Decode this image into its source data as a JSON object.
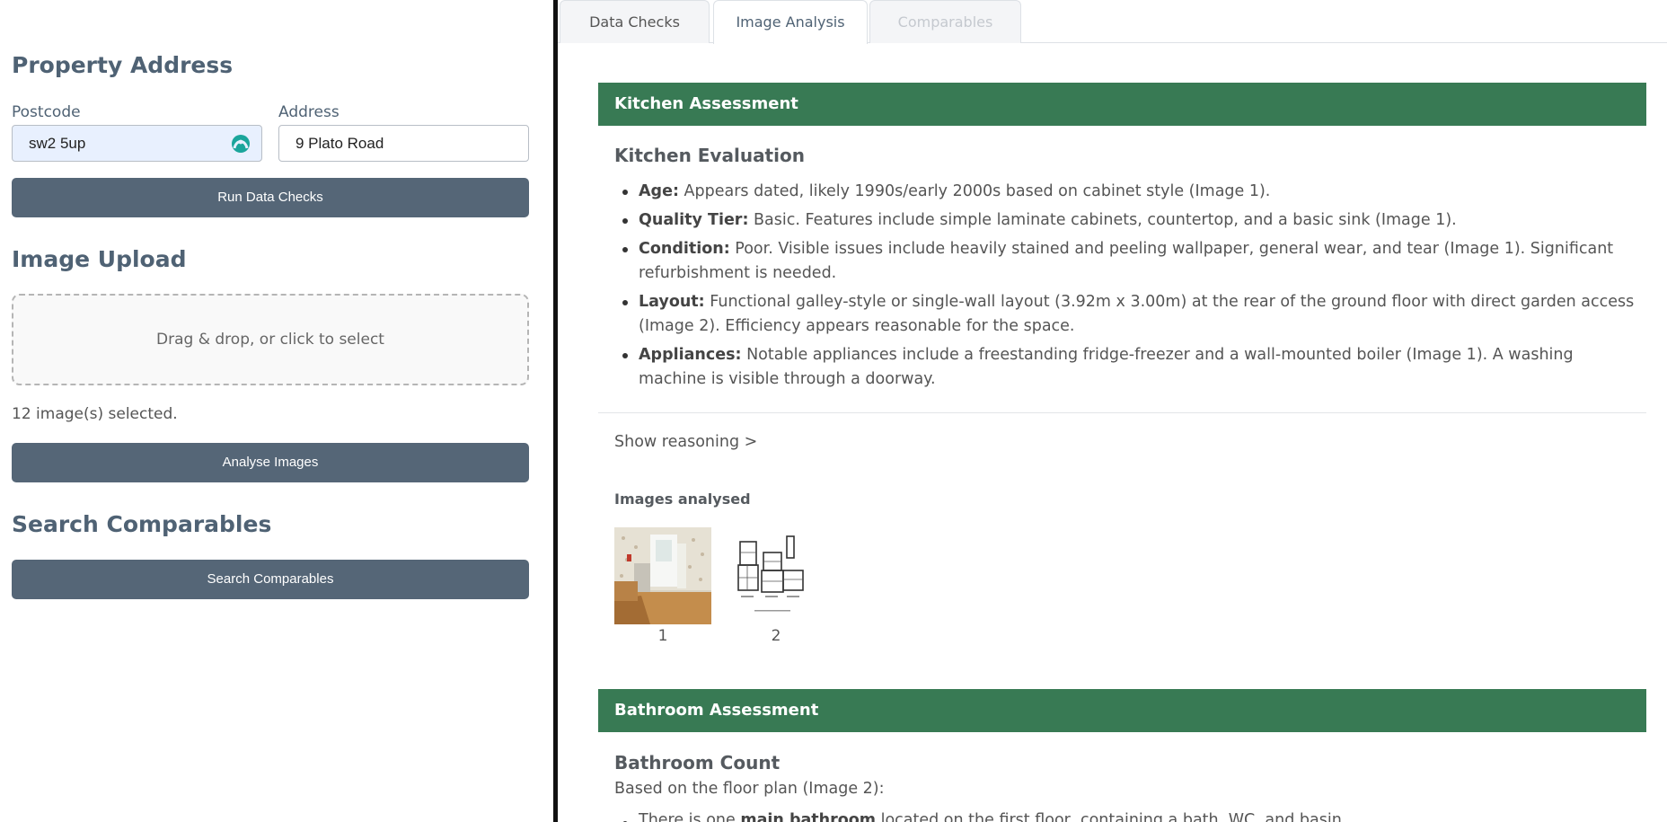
{
  "left_panel": {
    "property_address": {
      "heading": "Property Address",
      "postcode_label": "Postcode",
      "postcode_value": "sw2 5up",
      "address_label": "Address",
      "address_value": "9 Plato Road",
      "run_button": "Run Data Checks"
    },
    "image_upload": {
      "heading": "Image Upload",
      "dropzone_text": "Drag & drop, or click to select",
      "selected_text": "12 image(s) selected.",
      "analyse_button": "Analyse Images"
    },
    "comparables": {
      "heading": "Search Comparables",
      "search_button": "Search Comparables"
    }
  },
  "tabs": [
    {
      "label": "Data Checks",
      "state": "inactive"
    },
    {
      "label": "Image Analysis",
      "state": "active"
    },
    {
      "label": "Comparables",
      "state": "disabled"
    }
  ],
  "kitchen": {
    "section_title": "Kitchen Assessment",
    "subtitle": "Kitchen Evaluation",
    "items": [
      {
        "label": "Age:",
        "text": " Appears dated, likely 1990s/early 2000s based on cabinet style (Image 1)."
      },
      {
        "label": "Quality Tier:",
        "text": " Basic. Features include simple laminate cabinets, countertop, and a basic sink (Image 1)."
      },
      {
        "label": "Condition:",
        "text": " Poor. Visible issues include heavily stained and peeling wallpaper, general wear, and tear (Image 1). Significant refurbishment is needed."
      },
      {
        "label": "Layout:",
        "text": " Functional galley-style or single-wall layout (3.92m x 3.00m) at the rear of the ground floor with direct garden access (Image 2). Efficiency appears reasonable for the space."
      },
      {
        "label": "Appliances:",
        "text": " Notable appliances include a freestanding fridge-freezer and a wall-mounted boiler (Image 1). A washing machine is visible through a doorway."
      }
    ],
    "reasoning_link": "Show reasoning >",
    "images_title": "Images analysed",
    "images": [
      {
        "label": "1",
        "kind": "kitchen-photo"
      },
      {
        "label": "2",
        "kind": "floor-plan"
      }
    ]
  },
  "bathroom": {
    "section_title": "Bathroom Assessment",
    "subtitle": "Bathroom Count",
    "intro": "Based on the floor plan (Image 2):",
    "first_item_pre": "There is one ",
    "first_item_bold": "main bathroom",
    "first_item_post": " located on the first floor, containing a bath, WC, and basin."
  },
  "colors": {
    "accent_button": "#556677",
    "section_bar": "#387a54",
    "heading": "#4f6274"
  }
}
